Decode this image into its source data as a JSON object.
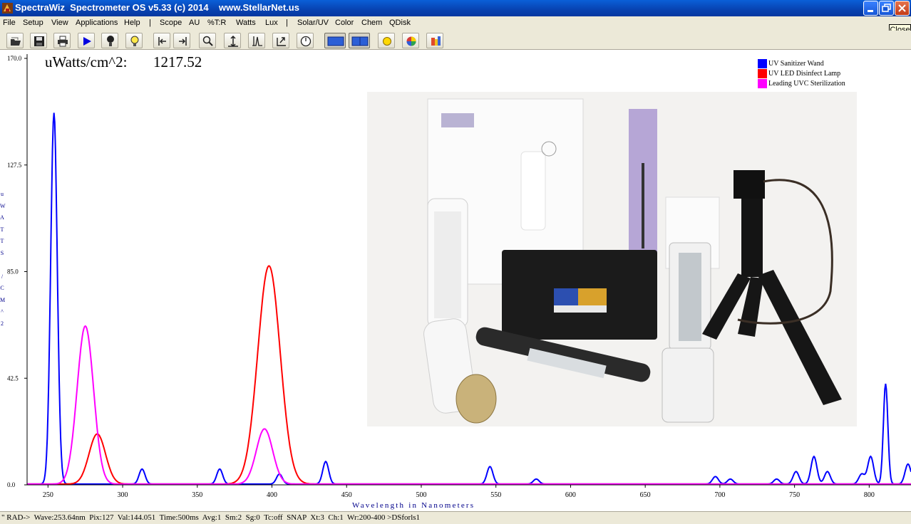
{
  "window": {
    "title": "SpectraWiz  Spectrometer OS v5.33 (c) 2014    www.StellarNet.us",
    "close_tooltip": "Close"
  },
  "menu": [
    {
      "id": "file",
      "label": "File"
    },
    {
      "id": "setup",
      "label": "Setup"
    },
    {
      "id": "view",
      "label": "View"
    },
    {
      "id": "applications",
      "label": "Applications"
    },
    {
      "id": "help",
      "label": "Help"
    },
    {
      "id": "sep1",
      "label": "|"
    },
    {
      "id": "scope",
      "label": "Scope"
    },
    {
      "id": "au",
      "label": "AU"
    },
    {
      "id": "ttr",
      "label": "%T:R"
    },
    {
      "id": "watts",
      "label": "Watts"
    },
    {
      "id": "lux",
      "label": "Lux"
    },
    {
      "id": "sep2",
      "label": "|"
    },
    {
      "id": "solar",
      "label": "Solar/UV"
    },
    {
      "id": "color",
      "label": "Color"
    },
    {
      "id": "chem",
      "label": "Chem"
    },
    {
      "id": "qdisk",
      "label": "QDisk"
    }
  ],
  "toolbar": [
    "open-icon",
    "save-icon",
    "print-icon",
    "play-icon",
    "probe-icon",
    "lamp-icon",
    "scroll-left-icon",
    "scroll-right-icon",
    "zoom-icon",
    "autoscale-icon",
    "peak-icon",
    "export-icon",
    "timer-icon",
    "single-graph-icon",
    "dual-graph-icon",
    "sun-icon",
    "color-wheel-icon",
    "palette-icon"
  ],
  "readout": {
    "label": "uWatts/cm^2:",
    "value": "1217.52"
  },
  "y_axis_vertical_label": [
    "u",
    "W",
    "A",
    "T",
    "T",
    "S",
    "",
    "/",
    "C",
    "M",
    "^",
    "2"
  ],
  "legend": [
    {
      "name": "UV Sanitizer Wand",
      "color": "#0000ff"
    },
    {
      "name": "UV LED Disinfect Lamp",
      "color": "#ff0000"
    },
    {
      "name": "Leading UVC Sterilization",
      "color": "#ff00ff"
    }
  ],
  "colors": {
    "axis": "#000000",
    "blue_series": "#0000ff",
    "red_series": "#ff0000",
    "magenta_series": "#ff00ff",
    "axis_title": "#00008b"
  },
  "status": {
    "text": "\" RAD->  Wave:253.64nm  Pix:127  Val:144.051  Time:500ms  Avg:1  Sm:2  Sg:0  Tc:off  SNAP  Xt:3  Ch:1  Wr:200-400 >DSforls1"
  },
  "chart_data": {
    "type": "line",
    "xlabel": "Wavelength in Nanometers",
    "ylabel": "uWATTS/CM^2",
    "xlim": [
      236,
      828
    ],
    "ylim": [
      0,
      170
    ],
    "x_ticks": [
      250,
      300,
      350,
      400,
      450,
      500,
      550,
      600,
      650,
      700,
      750,
      800
    ],
    "y_ticks": [
      0.0,
      42.5,
      85.0,
      127.5,
      170.0
    ],
    "y_tick_labels": [
      "0.0",
      "42.5",
      "85.0",
      "127.5",
      "170.0"
    ],
    "series": [
      {
        "name": "UV Sanitizer Wand",
        "color": "#0000ff",
        "peaks": [
          [
            254,
            148,
            2.2
          ],
          [
            313,
            6,
            2.0
          ],
          [
            365,
            6,
            2.0
          ],
          [
            405,
            4,
            2.0
          ],
          [
            436,
            9,
            2.0
          ],
          [
            546,
            7,
            2.0
          ],
          [
            577,
            2,
            2.0
          ],
          [
            697,
            3,
            2.0
          ],
          [
            707,
            2,
            2.0
          ],
          [
            738,
            2,
            2.0
          ],
          [
            751,
            5,
            2.0
          ],
          [
            763,
            11,
            2.0
          ],
          [
            772,
            5,
            2.0
          ],
          [
            795,
            4,
            2.0
          ],
          [
            801,
            11,
            2.0
          ],
          [
            811,
            40,
            1.5
          ],
          [
            826,
            8,
            2.0
          ]
        ]
      },
      {
        "name": "UV LED Disinfect Lamp",
        "color": "#ff0000",
        "peaks": [
          [
            283,
            20,
            5.5
          ],
          [
            398,
            87,
            7.5
          ]
        ]
      },
      {
        "name": "Leading UVC Sterilization",
        "color": "#ff00ff",
        "peaks": [
          [
            275,
            63,
            5.5
          ],
          [
            395,
            22,
            5.5
          ]
        ]
      }
    ]
  }
}
